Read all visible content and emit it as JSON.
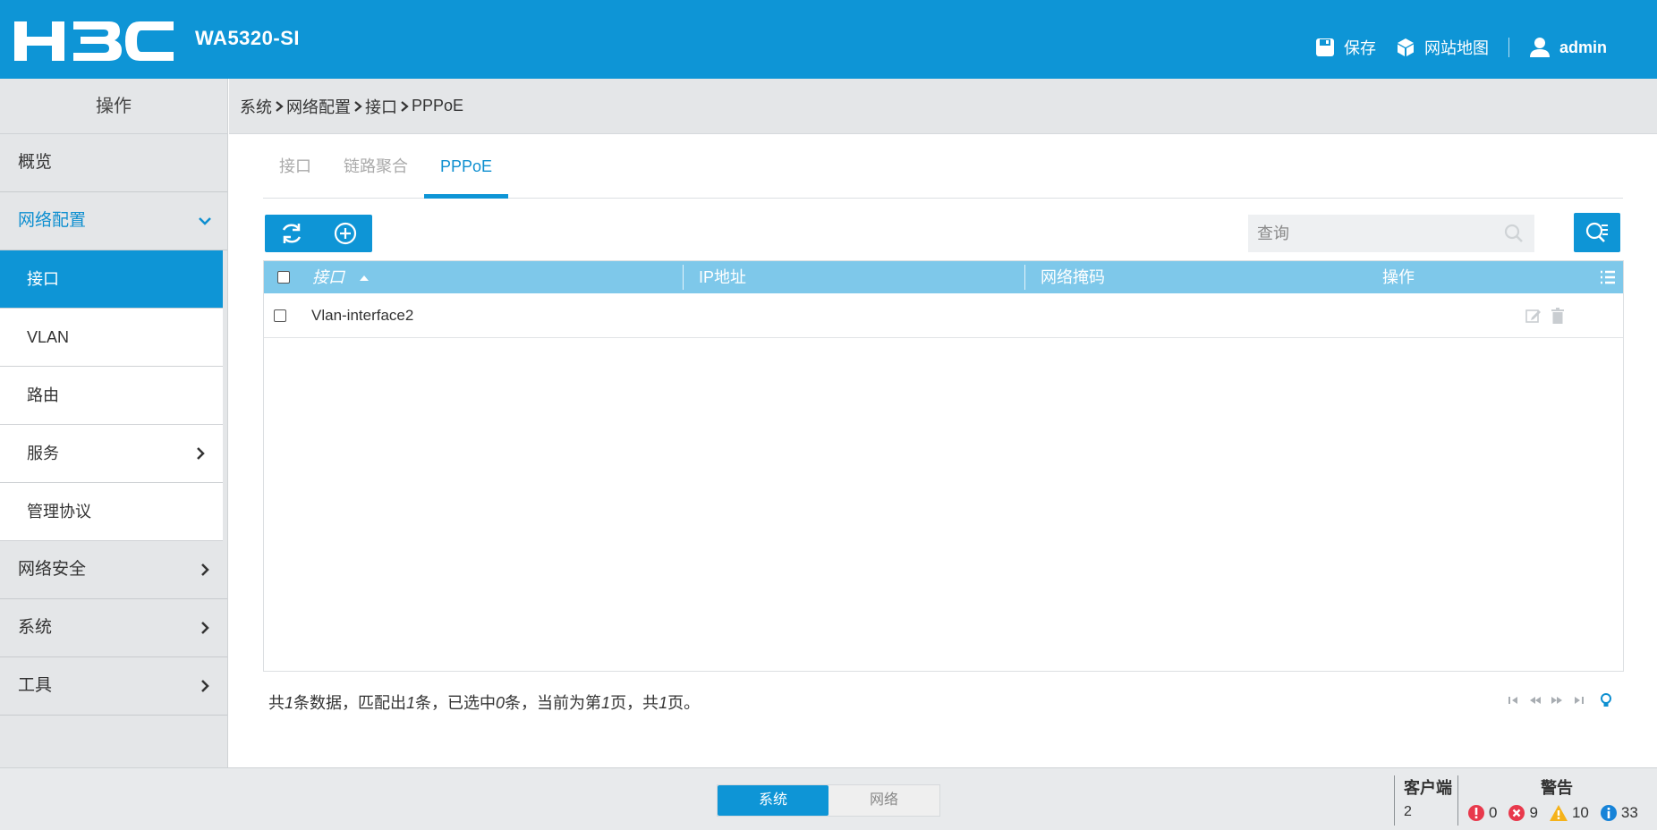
{
  "header": {
    "brand": "H3C",
    "model": "WA5320-SI",
    "save_label": "保存",
    "sitemap_label": "网站地图",
    "user": "admin"
  },
  "sidebar": {
    "title": "操作",
    "items": [
      {
        "label": "概览"
      },
      {
        "label": "网络配置",
        "expanded": true
      },
      {
        "label": "接口",
        "selected": true
      },
      {
        "label": "VLAN"
      },
      {
        "label": "路由"
      },
      {
        "label": "服务"
      },
      {
        "label": "管理协议"
      },
      {
        "label": "网络安全"
      },
      {
        "label": "系统"
      },
      {
        "label": "工具"
      }
    ]
  },
  "breadcrumb": [
    "系统",
    "网络配置",
    "接口",
    "PPPoE"
  ],
  "tabs": [
    {
      "label": "接口"
    },
    {
      "label": "链路聚合"
    },
    {
      "label": "PPPoE",
      "active": true
    }
  ],
  "search": {
    "placeholder": "查询"
  },
  "table": {
    "columns": [
      "接口",
      "IP地址",
      "网络掩码",
      "操作"
    ],
    "sort": "ascending",
    "rows": [
      {
        "interface": "Vlan-interface2",
        "ip": "",
        "mask": ""
      }
    ]
  },
  "summary": {
    "p1": "共",
    "total": "1",
    "p2": "条数据，匹配出",
    "matched": "1",
    "p3": "条，已选中",
    "selected": "0",
    "p4": "条，当前为第",
    "page": "1",
    "p5": "页，共",
    "pages": "1",
    "p6": "页。"
  },
  "footer": {
    "modes": [
      {
        "label": "系统",
        "active": true
      },
      {
        "label": "网络"
      }
    ],
    "clients_label": "客户端",
    "clients_value": "2",
    "alarms_label": "警告",
    "alarms": [
      {
        "type": "critical",
        "count": "0",
        "color": "#e8394c"
      },
      {
        "type": "error",
        "count": "9",
        "color": "#e8394c"
      },
      {
        "type": "warning",
        "count": "10",
        "color": "#f5b21a"
      },
      {
        "type": "info",
        "count": "33",
        "color": "#1683d8"
      }
    ]
  },
  "colors": {
    "primary": "#0e95d6",
    "table_header": "#7ec8ea",
    "sidebar_bg": "#e4e6e8"
  }
}
